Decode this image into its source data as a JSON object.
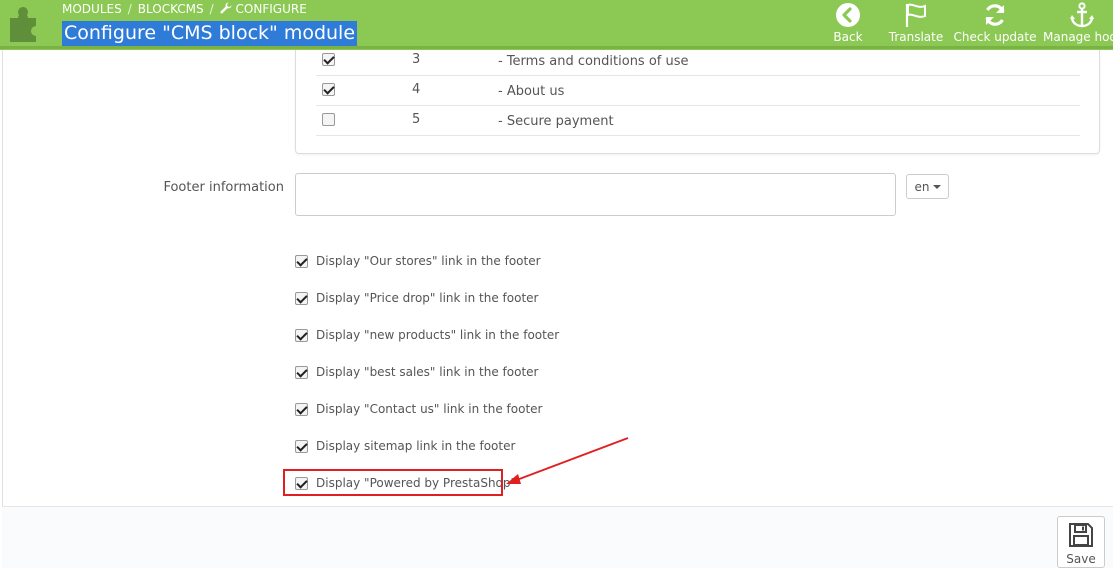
{
  "header": {
    "breadcrumb": [
      "MODULES",
      "BLOCKCMS",
      "CONFIGURE"
    ],
    "breadcrumb_sep": "/",
    "title": "Configure \"CMS block\" module",
    "toolbar": [
      {
        "label": "Back",
        "icon": "back-circle-icon"
      },
      {
        "label": "Translate",
        "icon": "flag-icon"
      },
      {
        "label": "Check update",
        "icon": "refresh-icon"
      },
      {
        "label": "Manage hooks",
        "icon": "anchor-icon"
      }
    ],
    "accent": "#8bc954",
    "title_highlight": "#2f7bd8"
  },
  "cms_pages": [
    {
      "id": "3",
      "name": "- Terms and conditions of use",
      "checked": true
    },
    {
      "id": "4",
      "name": "- About us",
      "checked": true
    },
    {
      "id": "5",
      "name": "- Secure payment",
      "checked": false
    }
  ],
  "footer_info": {
    "label": "Footer information",
    "value": "",
    "language": "en"
  },
  "options": [
    {
      "label": "Display \"Our stores\" link in the footer",
      "checked": true
    },
    {
      "label": "Display \"Price drop\" link in the footer",
      "checked": true
    },
    {
      "label": "Display \"new products\" link in the footer",
      "checked": true
    },
    {
      "label": "Display \"best sales\" link in the footer",
      "checked": true
    },
    {
      "label": "Display \"Contact us\" link in the footer",
      "checked": true
    },
    {
      "label": "Display sitemap link in the footer",
      "checked": true
    },
    {
      "label": "Display \"Powered by PrestaShop\"",
      "checked": true
    }
  ],
  "save": {
    "label": "Save"
  },
  "annotation_color": "#e02020"
}
